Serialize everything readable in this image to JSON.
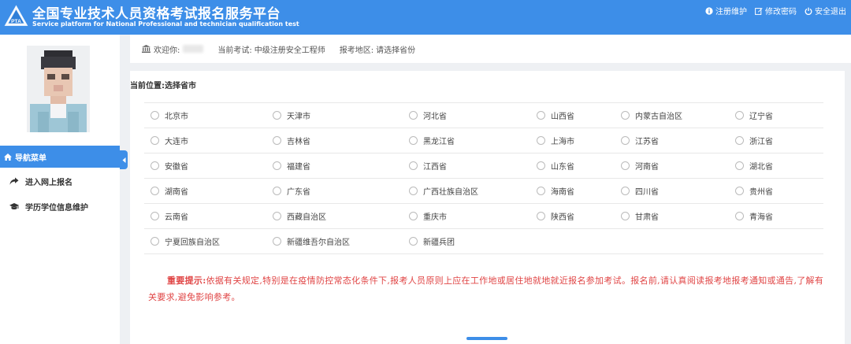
{
  "header": {
    "logo_text": "PTA",
    "title_cn": "全国专业技术人员资格考试报名服务平台",
    "title_en": "Service platform for National Professional and technician qualification test",
    "links": [
      {
        "label": "注册维护",
        "icon": "info-icon"
      },
      {
        "label": "修改密码",
        "icon": "edit-icon"
      },
      {
        "label": "安全退出",
        "icon": "power-icon"
      }
    ]
  },
  "sidebar": {
    "nav_header": "导航菜单",
    "items": [
      {
        "label": "进入网上报名",
        "icon": "share-arrow-icon"
      },
      {
        "label": "学历学位信息维护",
        "icon": "graduation-cap-icon"
      }
    ]
  },
  "welcome": {
    "welcome_label": "欢迎你:",
    "exam_label": "当前考试:",
    "exam_value": "中级注册安全工程师",
    "region_label": "报考地区:",
    "region_value": "请选择省份"
  },
  "main": {
    "breadcrumb": "当前位置:选择省市",
    "provinces": [
      [
        "北京市",
        "天津市",
        "河北省",
        "山西省",
        "内蒙古自治区",
        "辽宁省"
      ],
      [
        "大连市",
        "吉林省",
        "黑龙江省",
        "上海市",
        "江苏省",
        "浙江省"
      ],
      [
        "安徽省",
        "福建省",
        "江西省",
        "山东省",
        "河南省",
        "湖北省"
      ],
      [
        "湖南省",
        "广东省",
        "广西壮族自治区",
        "海南省",
        "四川省",
        "贵州省"
      ],
      [
        "云南省",
        "西藏自治区",
        "重庆市",
        "陕西省",
        "甘肃省",
        "青海省"
      ],
      [
        "宁夏回族自治区",
        "新疆维吾尔自治区",
        "新疆兵团"
      ]
    ],
    "notice_title": "重要提示:",
    "notice_body": "依据有关规定,特别是在疫情防控常态化条件下,报考人员原则上应在工作地或居住地就地就近报名参加考试。报名前,请认真阅读报考地报考通知或通告,了解有关要求,避免影响参考。"
  },
  "colors": {
    "primary": "#3d8ee8",
    "notice": "#e04545"
  }
}
